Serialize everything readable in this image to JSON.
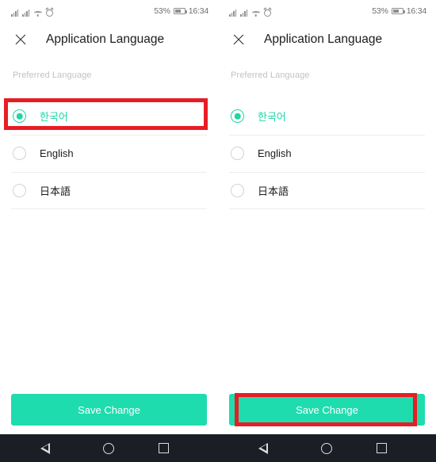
{
  "status_bar": {
    "signal_icon": "signal-bars-icon",
    "signal_icon_2": "signal-bars-icon",
    "wifi_icon": "wifi-icon",
    "alarm_icon": "alarm-clock-icon",
    "battery_percent": "53%",
    "battery_icon": "battery-icon",
    "time": "16:34"
  },
  "app_bar": {
    "close_icon": "close-x-icon",
    "title": "Application Language"
  },
  "section": {
    "label": "Preferred Language"
  },
  "languages": [
    {
      "label": "한국어",
      "selected": true,
      "radio_icon": "radio-selected-icon"
    },
    {
      "label": "English",
      "selected": false,
      "radio_icon": "radio-unselected-icon"
    },
    {
      "label": "日本語",
      "selected": false,
      "radio_icon": "radio-unselected-icon"
    }
  ],
  "save": {
    "label": "Save Change"
  },
  "nav_bar": {
    "back_icon": "back-triangle-icon",
    "home_icon": "home-circle-icon",
    "recent_icon": "recents-square-icon"
  },
  "annotations": {
    "left_panel_highlight": "korean-language-row",
    "right_panel_highlight": "save-change-button"
  },
  "colors": {
    "accent_teal": "#1fdcae",
    "radio_teal": "#1fd6a6",
    "highlight_red": "#e81c24",
    "nav_bar": "#1b1e25",
    "section_label": "#c2c2c2",
    "divider": "#ededed"
  }
}
